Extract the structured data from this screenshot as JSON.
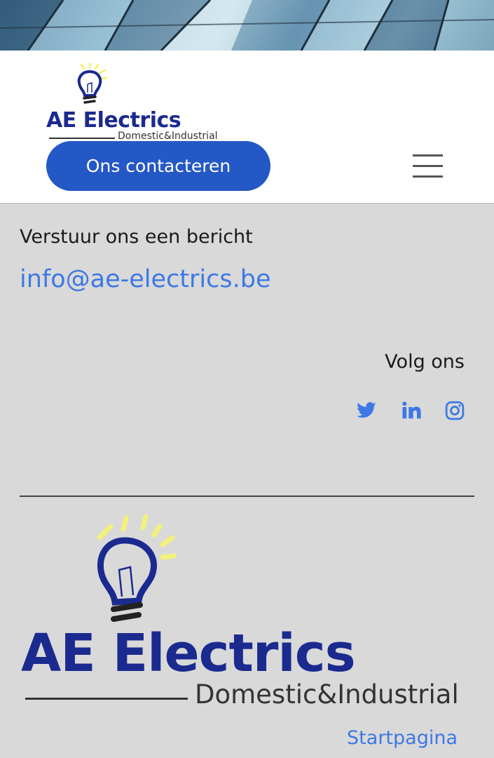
{
  "header": {
    "logo": {
      "name": "AE Electrics",
      "tagline": "Domestic&Industrial"
    },
    "contact_button": "Ons contacteren"
  },
  "contact": {
    "message_label": "Verstuur ons een bericht",
    "email": "info@ae-electrics.be"
  },
  "social": {
    "label": "Volg ons",
    "icons": [
      "twitter-icon",
      "linkedin-icon",
      "instagram-icon"
    ]
  },
  "footer": {
    "logo": {
      "name": "AE Electrics",
      "tagline": "Domestic&Industrial"
    },
    "home_link": "Startpagina"
  },
  "colors": {
    "brand_blue": "#1b2a8f",
    "button_blue": "#2458c6",
    "link_blue": "#3d78e6",
    "bulb_rays": "#f2f27a",
    "background": "#d9d9d9"
  }
}
